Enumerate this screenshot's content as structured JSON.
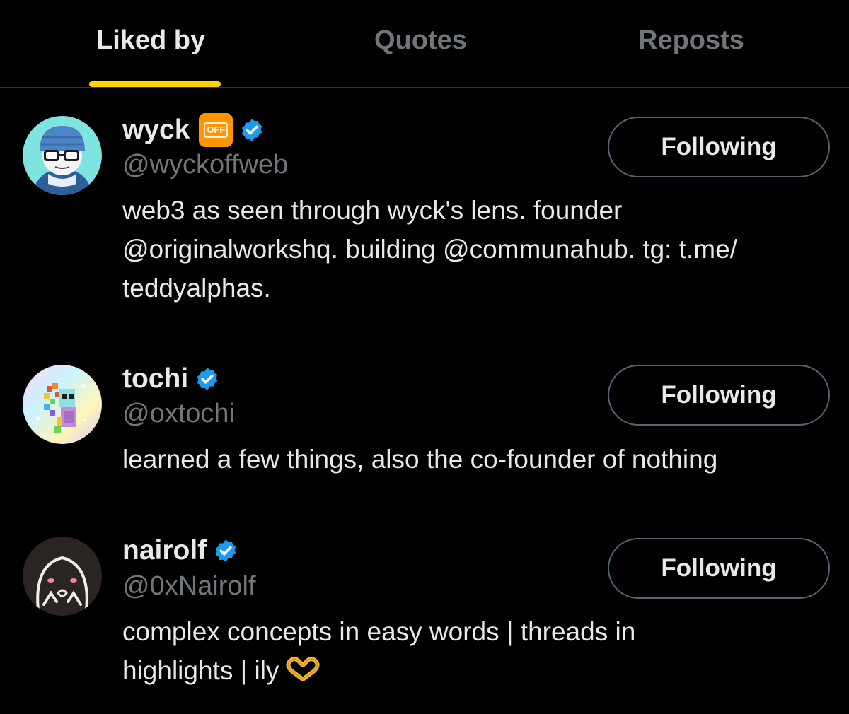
{
  "tabs": {
    "liked_by": "Liked by",
    "quotes": "Quotes",
    "reposts": "Reposts",
    "active": "liked_by",
    "indicator_color": "#ffd400"
  },
  "users": [
    {
      "name": "wyck",
      "handle": "@wyckoffweb",
      "badge": "OFF",
      "verified": true,
      "bio_lines": [
        "web3 as seen through wyck's lens. founder",
        "@originalworkshq. building @communahub. tg: t.me/",
        "teddyalphas."
      ],
      "follow_label": "Following"
    },
    {
      "name": "tochi",
      "handle": "@oxtochi",
      "verified": true,
      "bio_lines": [
        "learned a few things, also the co-founder of nothing"
      ],
      "follow_label": "Following"
    },
    {
      "name": "nairolf",
      "handle": "@0xNairolf",
      "verified": true,
      "bio_lines": [
        "complex concepts in easy words | threads in",
        "highlights | ily"
      ],
      "bio_emoji": "heart-hands-emoji",
      "follow_label": "Following"
    }
  ],
  "colors": {
    "background": "#000000",
    "text_primary": "#e7e9ea",
    "text_secondary": "#71767b",
    "verified_blue": "#1d9bf0",
    "badge_orange": "#ff9500",
    "button_border": "#536471"
  }
}
